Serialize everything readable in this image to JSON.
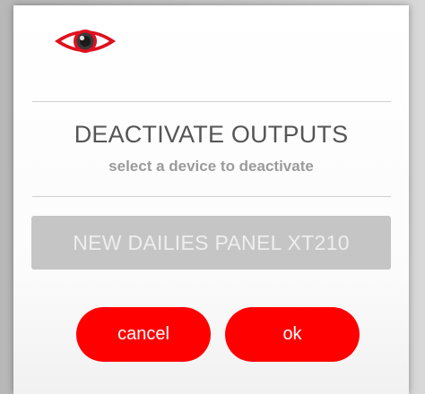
{
  "dialog": {
    "logo_icon": "eye-icon",
    "title": "DEACTIVATE OUTPUTS",
    "subtitle": "select a device to deactivate",
    "device_label": "NEW DAILIES PANEL XT210",
    "cancel_label": "cancel",
    "ok_label": "ok"
  },
  "colors": {
    "accent": "#ff0000",
    "device_bg": "#c5c5c5",
    "title_text": "#555555",
    "subtitle_text": "#9b9b9b"
  }
}
